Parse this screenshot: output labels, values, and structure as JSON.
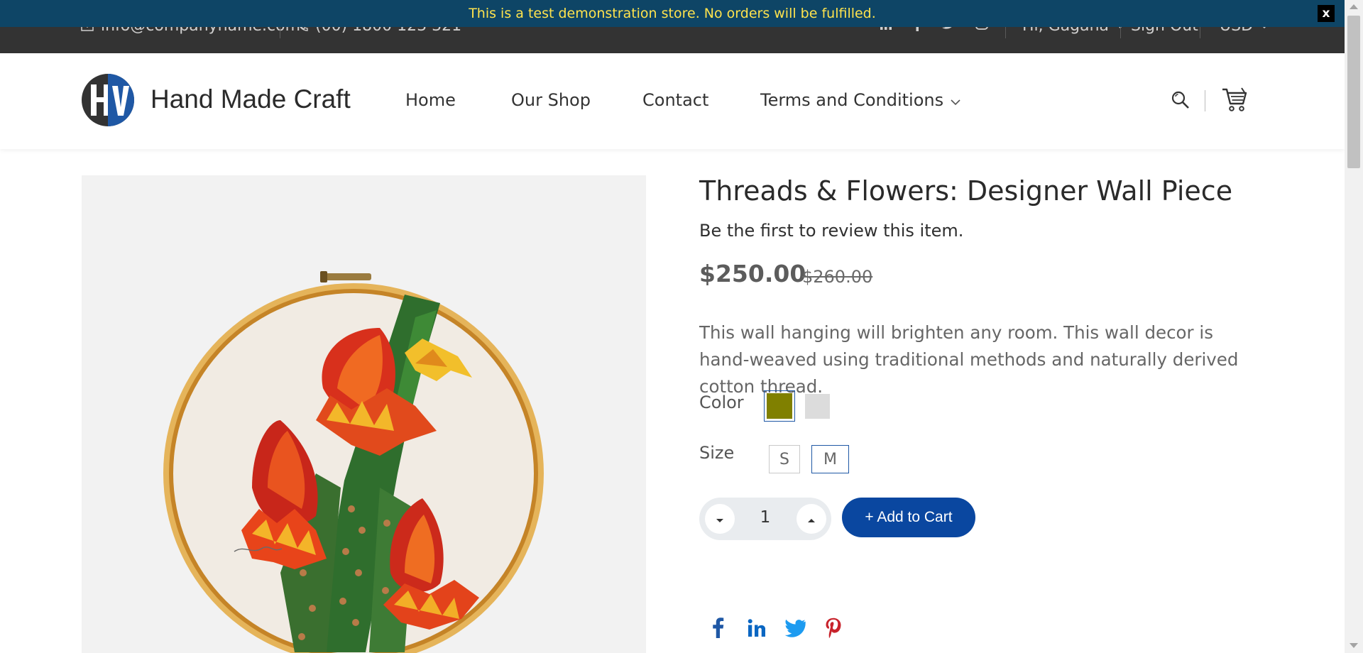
{
  "notice": {
    "text": "This is a test demonstration store. No orders will be fulfilled.",
    "close_label": "x"
  },
  "topbar": {
    "email": "info@companyname.com",
    "phone": "(00) 1800 123 321",
    "social_icons": [
      "linkedin-icon",
      "facebook-icon",
      "twitter-icon",
      "instagram-icon"
    ],
    "greeting": "Hi, Gagana",
    "sign_out": "Sign Out",
    "currency": "USD"
  },
  "header": {
    "brand": "Hand Made Craft",
    "nav": [
      {
        "label": "Home"
      },
      {
        "label": "Our Shop"
      },
      {
        "label": "Contact"
      },
      {
        "label": "Terms and Conditions"
      }
    ],
    "icons": [
      "search-icon",
      "cart-icon"
    ]
  },
  "product": {
    "title": "Threads & Flowers: Designer Wall Piece",
    "review_text": "Be the first to review this item.",
    "price": "$250.00",
    "old_price": "$260.00",
    "description": "This wall hanging will brighten any room. This wall decor is hand-weaved using traditional methods and naturally derived cotton thread.",
    "color_label": "Color",
    "colors": [
      {
        "name": "olive",
        "hex": "#808000",
        "selected": true
      },
      {
        "name": "light-gray",
        "hex": "#dcdcdc",
        "selected": false
      }
    ],
    "size_label": "Size",
    "sizes": [
      {
        "label": "S",
        "selected": false
      },
      {
        "label": "M",
        "selected": true
      }
    ],
    "quantity": "1",
    "add_to_cart": "+ Add to Cart",
    "share": [
      "facebook-icon",
      "linkedin-icon",
      "twitter-icon",
      "pinterest-icon"
    ]
  },
  "colors": {
    "notice_bg": "#0e4566",
    "notice_text": "#ffe34d",
    "topbar_bg": "#333333",
    "accent": "#0a47a0",
    "facebook": "#1f58a5",
    "linkedin": "#0a66c2",
    "twitter": "#1d9bf0",
    "pinterest": "#c8232c"
  }
}
